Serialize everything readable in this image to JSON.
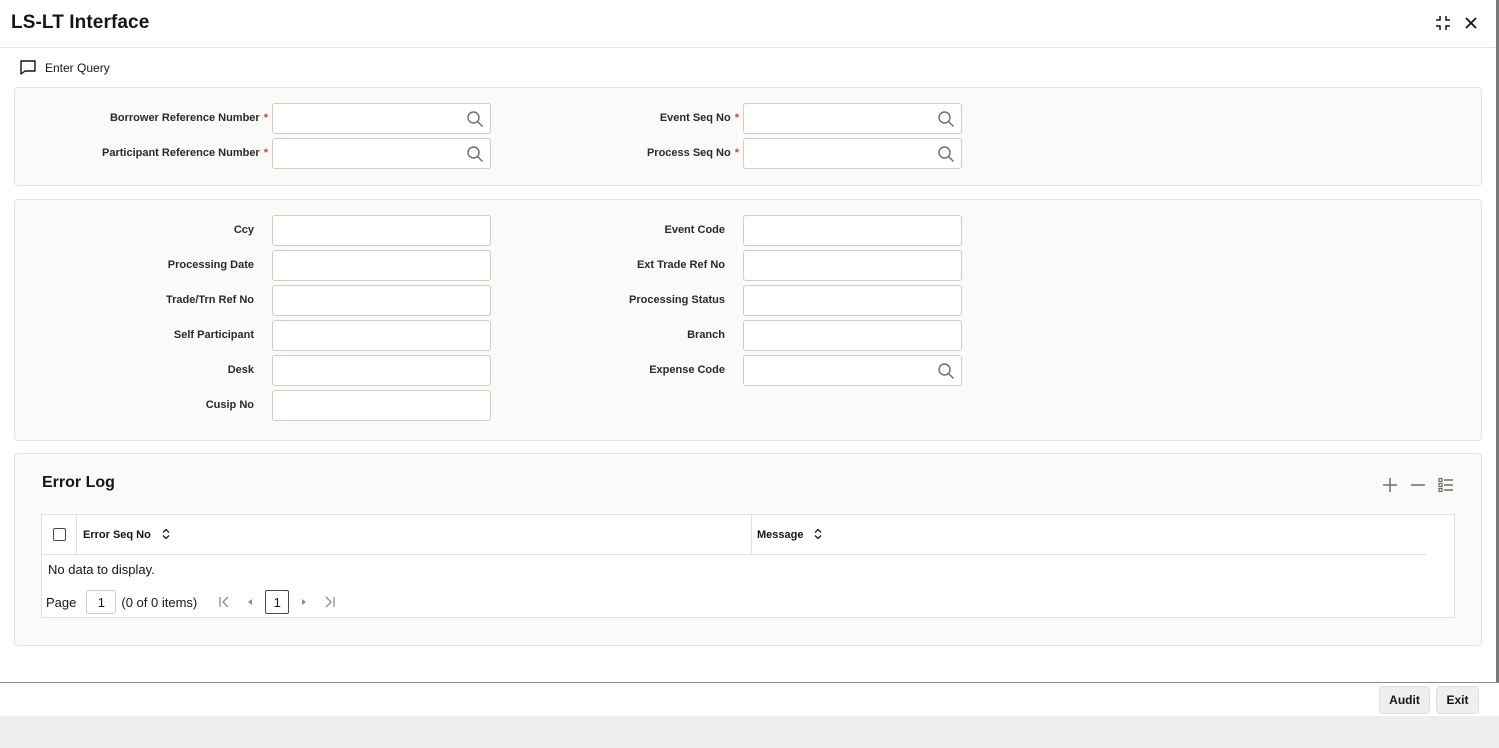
{
  "window": {
    "title": "LS-LT Interface",
    "maximize_icon": "collapse-arrows-icon",
    "close_icon": "close-icon"
  },
  "toolbar": {
    "enter_query_label": "Enter Query",
    "enter_query_icon": "speech-bubble-icon"
  },
  "key_fields": {
    "borrower_ref": {
      "label": "Borrower Reference Number",
      "required": "*",
      "value": ""
    },
    "participant_ref": {
      "label": "Participant Reference Number",
      "required": "*",
      "value": ""
    },
    "event_seq": {
      "label": "Event Seq No",
      "required": "*",
      "value": ""
    },
    "process_seq": {
      "label": "Process Seq No",
      "required": "*",
      "value": ""
    }
  },
  "details": {
    "ccy": {
      "label": "Ccy",
      "value": ""
    },
    "processing_date": {
      "label": "Processing Date",
      "value": ""
    },
    "trade_ref": {
      "label": "Trade/Trn Ref No",
      "value": ""
    },
    "self_participant": {
      "label": "Self Participant",
      "value": ""
    },
    "desk": {
      "label": "Desk",
      "value": ""
    },
    "cusip": {
      "label": "Cusip No",
      "value": ""
    },
    "event_code": {
      "label": "Event Code",
      "value": ""
    },
    "ext_trade_ref": {
      "label": "Ext Trade Ref No",
      "value": ""
    },
    "processing_status": {
      "label": "Processing Status",
      "value": ""
    },
    "branch": {
      "label": "Branch",
      "value": ""
    },
    "expense_code": {
      "label": "Expense Code",
      "value": ""
    }
  },
  "error_log": {
    "title": "Error Log",
    "columns": [
      "Error Seq No",
      "Message"
    ],
    "empty_text": "No data to display.",
    "pager": {
      "page_label": "Page",
      "page_value": "1",
      "items_text": "(0 of 0 items)",
      "current_page": "1"
    }
  },
  "footer": {
    "audit_label": "Audit",
    "exit_label": "Exit"
  },
  "colors": {
    "required": "#c74634",
    "panel_bg": "#fbfaf8",
    "border": "#cfccc6"
  }
}
